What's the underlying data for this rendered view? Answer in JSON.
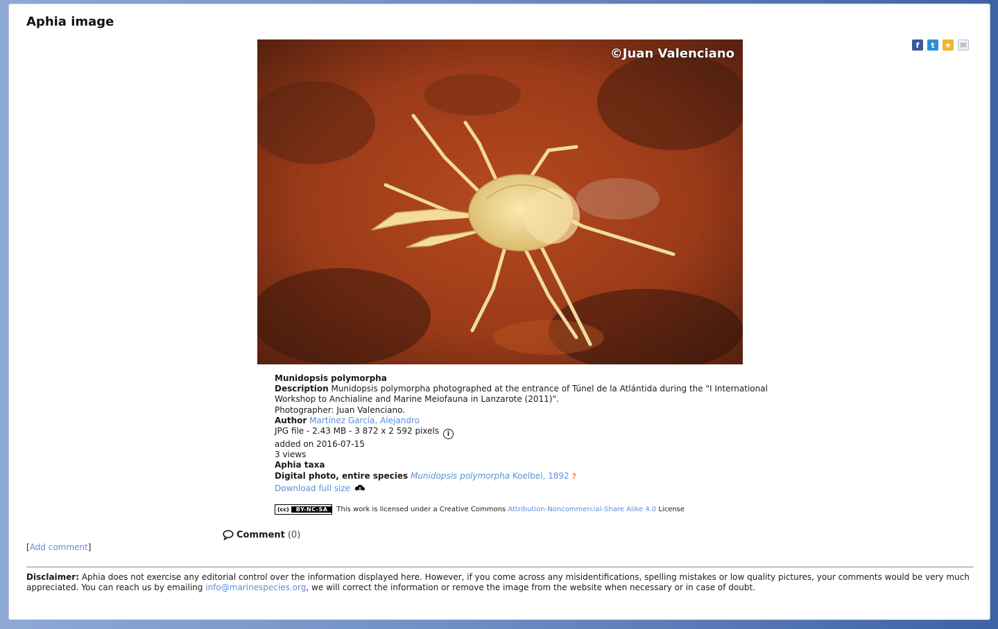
{
  "page": {
    "title": "Aphia image"
  },
  "share_icons": [
    "facebook-icon",
    "twitter-icon",
    "favorite-icon",
    "email-icon"
  ],
  "photo": {
    "copyright": "©Juan Valenciano"
  },
  "details": {
    "species": "Munidopsis polymorpha",
    "description_label": "Description",
    "description_text": "Munidopsis polymorpha photographed at the entrance of Túnel de la Atlántida during the \"I International Workshop to Anchialine and Marine Meiofauna in Lanzarote (2011)\".",
    "photographer": "Photographer: Juan Valenciano.",
    "author_label": "Author",
    "author_name": "Martínez García, Alejandro",
    "file_info": "JPG file - 2.43 MB - 3 872 x 2 592 pixels",
    "added_on": "added on 2016-07-15",
    "views": "3 views",
    "aphia_taxa_label": "Aphia taxa",
    "taxa_type": "Digital photo, entire species",
    "taxa_name": "Munidopsis polymorpha",
    "taxa_authority": "Koelbel, 1892",
    "taxa_qmark": "?",
    "download_label": "Download full size"
  },
  "license": {
    "cc": "(cc)",
    "terms": "BY-NC-SA",
    "prefix": "This work is licensed under a Creative Commons",
    "link": "Attribution-Noncommercial-Share Alike 4.0",
    "suffix": "License"
  },
  "comments": {
    "label": "Comment",
    "count": "(0)",
    "add_comment": "Add comment"
  },
  "disclaimer": {
    "label": "Disclaimer:",
    "text1": "Aphia does not exercise any editorial control over the information displayed here. However, if you come across any misidentifications, spelling mistakes or low quality pictures, your comments would be very much appreciated. You can reach us by emailing",
    "email": "info@marinespecies.org",
    "text2": ", we will correct the information or remove the image from the website when necessary or in case of doubt."
  },
  "colors": {
    "link": "#5a8fd8",
    "background": "#3e62a6",
    "rock": "#a4401c",
    "crab": "#f1d98f"
  }
}
